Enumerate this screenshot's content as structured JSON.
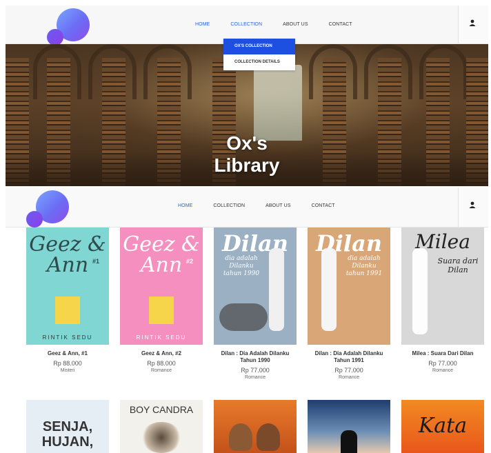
{
  "nav": {
    "items": [
      "HOME",
      "COLLECTION",
      "ABOUT US",
      "CONTACT"
    ],
    "dropdown": [
      "OX'S COLLECTION",
      "COLLECTION DETAILS"
    ],
    "user_icon": "user-icon"
  },
  "hero": {
    "title_line1": "Ox's",
    "title_line2": "Library"
  },
  "books": [
    {
      "title": "Geez & Ann, #1",
      "price": "Rp 88.000",
      "category": "Misteri",
      "cover_title": "Geez & Ann",
      "cover_num": "#1",
      "cover_author": "RINTIK SEDU"
    },
    {
      "title": "Geez & Ann, #2",
      "price": "Rp 88.000",
      "category": "Romance",
      "cover_title": "Geez & Ann",
      "cover_num": "#2",
      "cover_author": "RINTIK SEDU"
    },
    {
      "title": "Dilan : Dia Adalah Dilanku Tahun 1990",
      "price": "Rp 77.000",
      "category": "Romance",
      "cover_title": "Dilan",
      "cover_sub": "dia adalah Dilanku tahun 1990"
    },
    {
      "title": "Dilan : Dia Adalah Dilanku Tahun 1991",
      "price": "Rp 77.000",
      "category": "Romance",
      "cover_title": "Dilan",
      "cover_sub": "dia adalah Dilanku tahun 1991"
    },
    {
      "title": "Milea : Suara Dari Dilan",
      "price": "Rp 77.000",
      "category": "Romance",
      "cover_title": "Milea",
      "cover_sub": "Suara dari Dilan"
    }
  ],
  "books_row2": [
    {
      "cover_title": "SENJA, HUJAN,"
    },
    {
      "cover_title": "BOY CANDRA"
    },
    {
      "cover_title": ""
    },
    {
      "cover_title": ""
    },
    {
      "cover_title": "Kata"
    }
  ],
  "colors": {
    "accent": "#2b5ee3",
    "dropdown_active": "#1d4fe0"
  }
}
